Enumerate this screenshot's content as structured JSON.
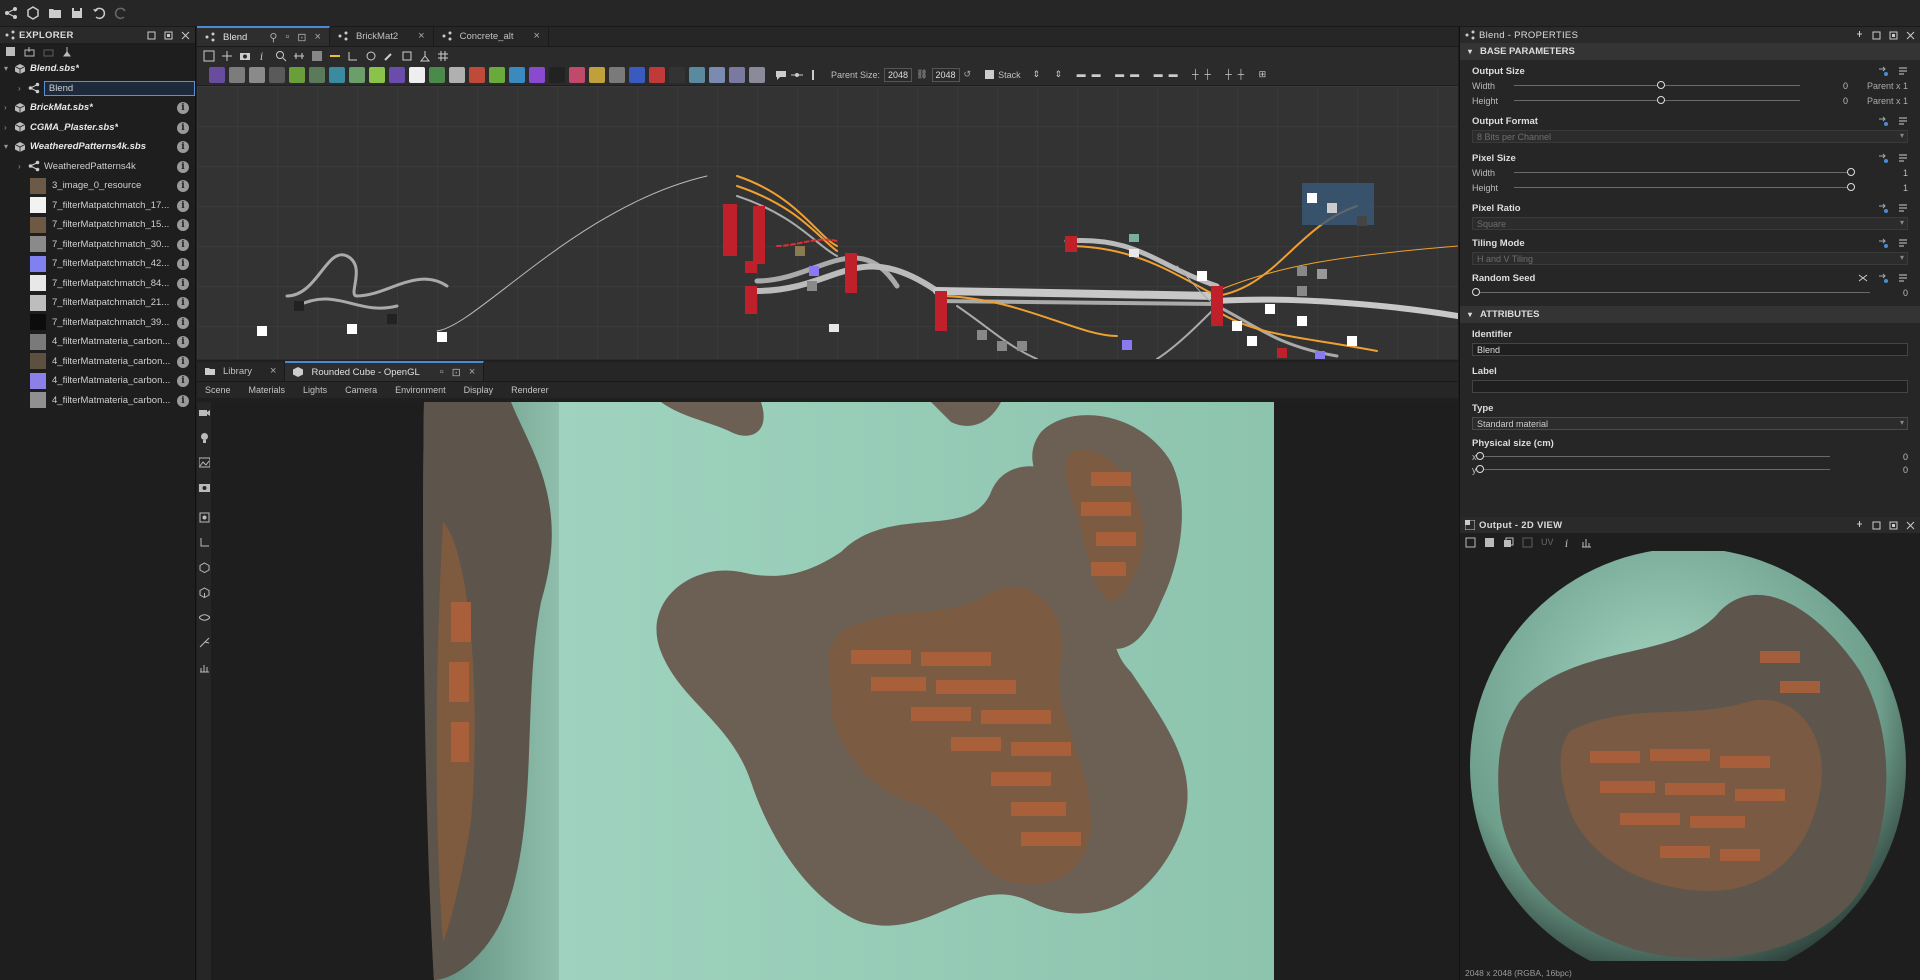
{
  "topbar": {
    "icons": [
      "graph-icon",
      "new-icon",
      "open-icon",
      "save-icon",
      "undo-icon",
      "redo-icon"
    ]
  },
  "explorer": {
    "title": "EXPLORER",
    "items": [
      {
        "label": "Blend.sbs*",
        "type": "package",
        "bold": true,
        "expanded": true
      },
      {
        "label": "Blend",
        "type": "graph",
        "selected": true
      },
      {
        "label": "BrickMat.sbs*",
        "type": "package",
        "bold": true
      },
      {
        "label": "CGMA_Plaster.sbs*",
        "type": "package",
        "bold": true
      },
      {
        "label": "WeatheredPatterns4k.sbs",
        "type": "package",
        "bold": true,
        "expanded": true
      },
      {
        "label": "WeatheredPatterns4k",
        "type": "graph"
      },
      {
        "label": "3_image_0_resource",
        "type": "resource",
        "color": "#6b5a45"
      },
      {
        "label": "7_filterMatpatchmatch_17...",
        "type": "resource",
        "color": "#f2f2f2"
      },
      {
        "label": "7_filterMatpatchmatch_15...",
        "type": "resource",
        "color": "#6e5a44"
      },
      {
        "label": "7_filterMatpatchmatch_30...",
        "type": "resource",
        "color": "#8a8a8a"
      },
      {
        "label": "7_filterMatpatchmatch_42...",
        "type": "resource",
        "color": "#8080f0"
      },
      {
        "label": "7_filterMatpatchmatch_84...",
        "type": "resource",
        "color": "#e8e8e8"
      },
      {
        "label": "7_filterMatpatchmatch_21...",
        "type": "resource",
        "color": "#bdbdbd"
      },
      {
        "label": "7_filterMatpatchmatch_39...",
        "type": "resource",
        "color": "#0c0c0c"
      },
      {
        "label": "4_filterMatmateria_carbon...",
        "type": "resource",
        "color": "#7a7a7a"
      },
      {
        "label": "4_filterMatmateria_carbon...",
        "type": "resource",
        "color": "#5e5040"
      },
      {
        "label": "4_filterMatmateria_carbon...",
        "type": "resource",
        "color": "#8a80e8"
      },
      {
        "label": "4_filterMatmateria_carbon...",
        "type": "resource",
        "color": "#909090"
      }
    ]
  },
  "graph": {
    "tabs": [
      {
        "label": "Blend",
        "active": true
      },
      {
        "label": "BrickMat2",
        "active": false
      },
      {
        "label": "Concrete_alt",
        "active": false
      }
    ],
    "parent_size_label": "Parent Size:",
    "parent_size_w": "2048",
    "parent_size_h": "2048",
    "stack_label": "Stack"
  },
  "viewport": {
    "tabs": [
      {
        "label": "Library",
        "active": false
      },
      {
        "label": "Rounded Cube - OpenGL",
        "active": true
      }
    ],
    "menu": [
      "Scene",
      "Materials",
      "Lights",
      "Camera",
      "Environment",
      "Display",
      "Renderer"
    ]
  },
  "properties": {
    "title": "Blend - PROPERTIES",
    "base_section": "BASE PARAMETERS",
    "output_size": {
      "title": "Output Size",
      "width_label": "Width",
      "height_label": "Height",
      "width_value": "0",
      "height_value": "0",
      "width_parent": "Parent x 1",
      "height_parent": "Parent x 1"
    },
    "output_format": {
      "title": "Output Format",
      "value": "8 Bits per Channel"
    },
    "pixel_size": {
      "title": "Pixel Size",
      "width_label": "Width",
      "height_label": "Height",
      "width_value": "1",
      "height_value": "1"
    },
    "pixel_ratio": {
      "title": "Pixel Ratio",
      "value": "Square"
    },
    "tiling_mode": {
      "title": "Tiling Mode",
      "value": "H and V Tiling"
    },
    "random_seed": {
      "title": "Random Seed",
      "value": "0"
    },
    "attributes_section": "ATTRIBUTES",
    "identifier": {
      "title": "Identifier",
      "value": "Blend"
    },
    "label": {
      "title": "Label",
      "value": ""
    },
    "type": {
      "title": "Type",
      "value": "Standard material"
    },
    "physical_size": {
      "title": "Physical size (cm)",
      "x_label": "x",
      "y_label": "y",
      "x_value": "0",
      "y_value": "0"
    }
  },
  "view2d": {
    "title": "Output - 2D VIEW",
    "uv_label": "UV",
    "status": "2048 x 2048 (RGBA, 16bpc)"
  },
  "colors": {
    "accent": "#4b8bd4",
    "wire_orange": "#f0a030",
    "wire_grey": "#a8a8a8",
    "node_red": "#c0202a",
    "plaster": "#8fc4ae",
    "stone": "#6e6256",
    "brick": "#b0613a"
  }
}
